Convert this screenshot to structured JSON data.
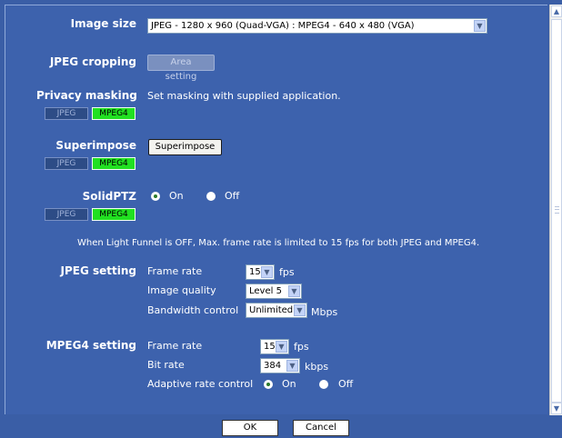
{
  "image_size": {
    "label": "Image size",
    "value": "JPEG - 1280 x 960 (Quad-VGA) : MPEG4 - 640 x 480 (VGA)"
  },
  "jpeg_cropping": {
    "label": "JPEG cropping",
    "button": "Area setting"
  },
  "privacy_masking": {
    "label": "Privacy masking",
    "description": "Set masking with supplied application.",
    "badge_jpeg": "JPEG",
    "badge_mpeg4": "MPEG4"
  },
  "superimpose": {
    "label": "Superimpose",
    "button": "Superimpose",
    "badge_jpeg": "JPEG",
    "badge_mpeg4": "MPEG4"
  },
  "solidptz": {
    "label": "SolidPTZ",
    "on": "On",
    "off": "Off",
    "selected": "On",
    "badge_jpeg": "JPEG",
    "badge_mpeg4": "MPEG4"
  },
  "notice": "When Light Funnel is OFF, Max. frame rate is limited to 15 fps for both JPEG and MPEG4.",
  "jpeg_setting": {
    "label": "JPEG setting",
    "frame_rate_label": "Frame rate",
    "frame_rate_value": "15",
    "frame_rate_unit": "fps",
    "image_quality_label": "Image quality",
    "image_quality_value": "Level 5",
    "bandwidth_label": "Bandwidth control",
    "bandwidth_value": "Unlimited",
    "bandwidth_unit": "Mbps"
  },
  "mpeg4_setting": {
    "label": "MPEG4 setting",
    "frame_rate_label": "Frame rate",
    "frame_rate_value": "15",
    "frame_rate_unit": "fps",
    "bit_rate_label": "Bit rate",
    "bit_rate_value": "384",
    "bit_rate_unit": "kbps",
    "adaptive_label": "Adaptive rate control",
    "on": "On",
    "off": "Off",
    "selected": "On"
  },
  "footer": {
    "ok": "OK",
    "cancel": "Cancel"
  },
  "icons": {
    "dropdown": "chevron-down-icon",
    "scroll_up": "scroll-up-icon",
    "scroll_down": "scroll-down-icon"
  }
}
